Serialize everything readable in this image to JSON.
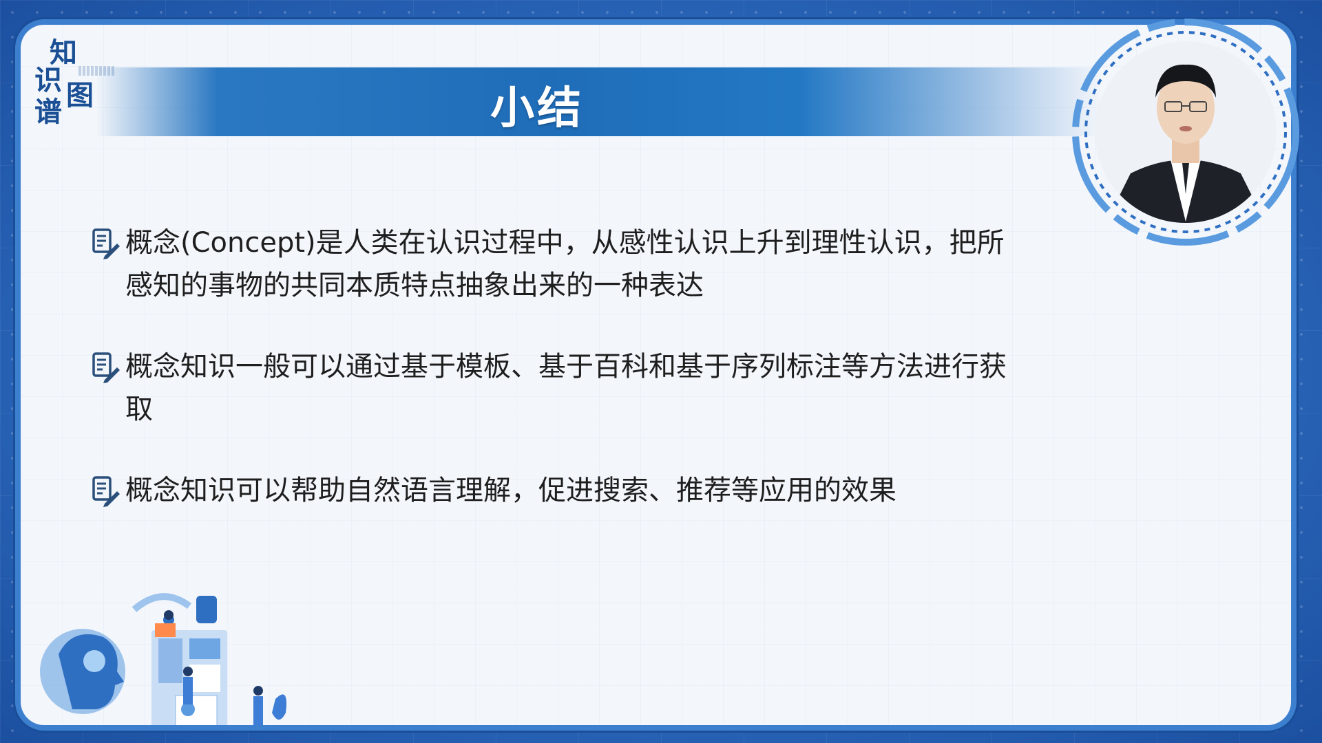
{
  "logo": {
    "chars": [
      "知",
      "识",
      "图",
      "谱"
    ]
  },
  "slide": {
    "title": "小结",
    "bullets": [
      {
        "text": "概念(Concept)是人类在认识过程中，从感性认识上升到理性认识，把所感知的事物的共同本质特点抽象出来的一种表达",
        "icon": "note-pen-icon"
      },
      {
        "text": "概念知识一般可以通过基于模板、基于百科和基于序列标注等方法进行获取",
        "icon": "note-pen-icon"
      },
      {
        "text": "概念知识可以帮助自然语言理解，促进搜索、推荐等应用的效果",
        "icon": "note-pen-icon"
      }
    ]
  },
  "colors": {
    "accent": "#1f6db9",
    "logo": "#1a4f95",
    "panel_bg": "#f3f6fb",
    "frame": "#3c7fcf",
    "text": "#1e1e1e"
  }
}
